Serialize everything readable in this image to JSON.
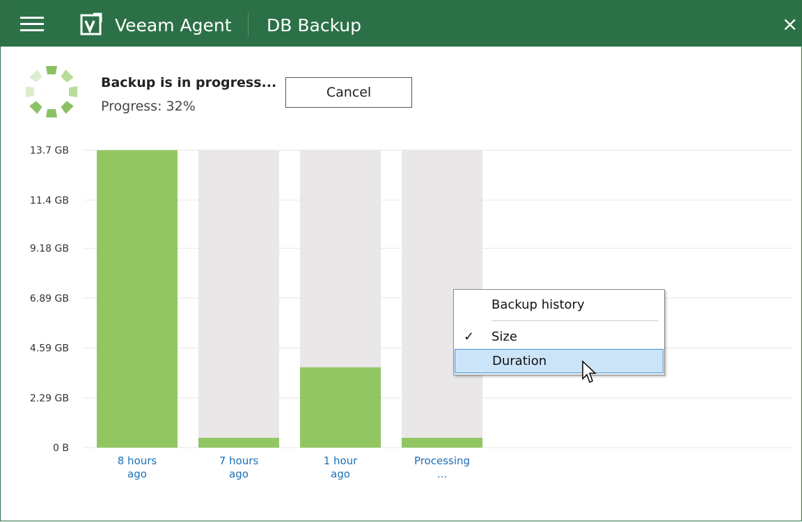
{
  "window": {
    "app_title": "Veeam Agent",
    "job_title": "DB Backup",
    "close_glyph": "×",
    "icons": [
      "hamburger-menu-icon",
      "veeam-logo-icon",
      "close-icon",
      "spinner-icon"
    ]
  },
  "status": {
    "title": "Backup is in progress...",
    "progress_text": "Progress: 32%",
    "progress_value": 32,
    "cancel_label": "Cancel"
  },
  "context_menu": {
    "header": "Backup history",
    "items": [
      {
        "label": "Size",
        "checked": true,
        "check_glyph": "✓"
      },
      {
        "label": "Duration",
        "checked": false,
        "highlighted": true
      }
    ]
  },
  "chart_data": {
    "type": "bar",
    "categories": [
      "8 hours\nago",
      "7 hours\nago",
      "1 hour\nago",
      "Processing\n..."
    ],
    "values": [
      13.7,
      0.45,
      3.7,
      0.45
    ],
    "ytick_labels": [
      "13.7 GB",
      "11.4 GB",
      "9.18 GB",
      "6.89 GB",
      "4.59 GB",
      "2.29 GB",
      "0 B"
    ],
    "ytick_values": [
      13.7,
      11.4,
      9.18,
      6.89,
      4.59,
      2.29,
      0
    ],
    "ylim": [
      0,
      13.7
    ],
    "grid": true,
    "colors": {
      "bar": "#92c663",
      "bar_background": "#e9e7e8",
      "grid": "#e6e6e6",
      "category_text": "#1b6fb6"
    }
  }
}
